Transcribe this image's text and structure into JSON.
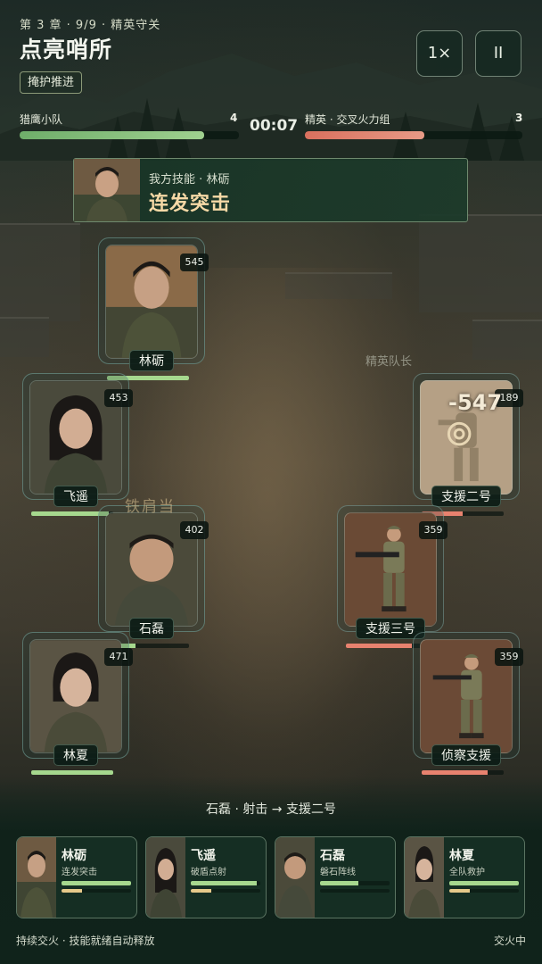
{
  "header": {
    "chapter": "第 3 章 · 9/9 · 精英守关",
    "title": "点亮哨所",
    "tag": "掩护推进",
    "speed_label": "1×",
    "pause_label": "II"
  },
  "battle": {
    "ally_team": {
      "name": "猎鹰小队",
      "count": "4",
      "health_fraction": 0.84,
      "color": "#9fd08f"
    },
    "enemy_team": {
      "name": "精英 · 交叉火力组",
      "count": "3",
      "health_fraction": 0.55,
      "color": "#e79a86"
    },
    "timer": "00:07"
  },
  "skill_banner": {
    "subtitle": "我方技能 · 林砺",
    "skill_name": "连发突击"
  },
  "allies": [
    {
      "name": "林砺",
      "hp": "545",
      "hp_fraction": 1.0,
      "icon": "soldier-portrait-icon"
    },
    {
      "name": "飞遥",
      "hp": "453",
      "hp_fraction": 0.95,
      "icon": "soldier-portrait-icon"
    },
    {
      "name": "石磊",
      "hp": "402",
      "hp_fraction": 0.35,
      "icon": "soldier-portrait-icon"
    },
    {
      "name": "林夏",
      "hp": "471",
      "hp_fraction": 1.0,
      "icon": "soldier-portrait-icon"
    }
  ],
  "enemies": [
    {
      "name": "支援二号",
      "hp": "189",
      "hp_fraction": 0.5,
      "icon": "enemy-soldier-icon"
    },
    {
      "name": "支援三号",
      "hp": "359",
      "hp_fraction": 0.8,
      "icon": "enemy-gunner-icon"
    },
    {
      "name": "侦察支援",
      "hp": "359",
      "hp_fraction": 0.8,
      "icon": "enemy-rifleman-icon"
    }
  ],
  "field": {
    "elite_label": "精英队长",
    "damage_number": "-547",
    "ghost_text": "铁肩当"
  },
  "combat_log": "石磊 · 射击 → 支援二号",
  "roster": [
    {
      "name": "林砺",
      "skill": "连发突击",
      "hp_fraction": 1.0,
      "charge_fraction": 0.3
    },
    {
      "name": "飞遥",
      "skill": "破盾点射",
      "hp_fraction": 0.95,
      "charge_fraction": 0.3
    },
    {
      "name": "石磊",
      "skill": "磐石阵线",
      "hp_fraction": 0.55,
      "charge_fraction": 0.0
    },
    {
      "name": "林夏",
      "skill": "全队救护",
      "hp_fraction": 1.0,
      "charge_fraction": 0.3
    }
  ],
  "footer": {
    "status": "持续交火 · 技能就绪自动释放",
    "state": "交火中"
  },
  "colors": {
    "ally_hp": "#a6d88e",
    "enemy_hp": "#e8826f",
    "charge": "#e6c98a"
  }
}
